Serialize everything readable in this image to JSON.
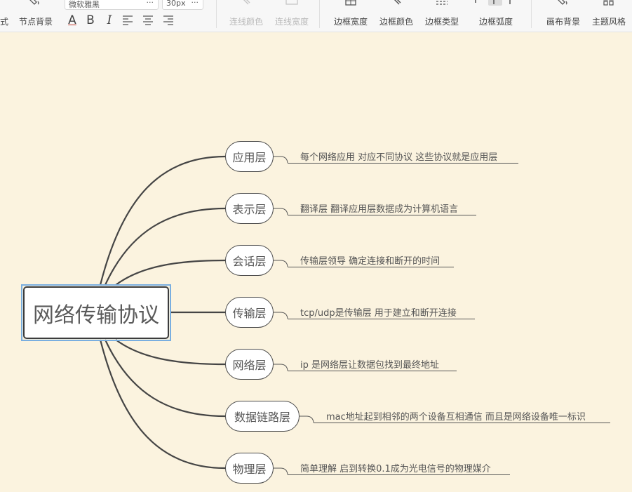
{
  "toolbar": {
    "left_clip": "式",
    "node_bg": "节点背景",
    "font_name": "微软雅黑",
    "font_size": "30px",
    "more": "···",
    "text_color": "A",
    "bold": "B",
    "italic": "I",
    "line_color": "连线颜色",
    "line_width": "连线宽度",
    "border_width": "边框宽度",
    "border_color": "边框颜色",
    "border_type": "边框类型",
    "border_radius": "边框弧度",
    "canvas_bg": "画布背景",
    "theme_style": "主题风格"
  },
  "mindmap": {
    "root": "网络传输协议",
    "branches": [
      {
        "label": "应用层",
        "note": "每个网络应用 对应不同协议 这些协议就是应用层"
      },
      {
        "label": "表示层",
        "note": "翻译层 翻译应用层数据成为计算机语言"
      },
      {
        "label": "会话层",
        "note": "传输层领导 确定连接和断开的时间"
      },
      {
        "label": "传输层",
        "note": "tcp/udp是传输层 用于建立和断开连接"
      },
      {
        "label": "网络层",
        "note": "ip 是网络层让数据包找到最终地址"
      },
      {
        "label": "数据链路层",
        "note": "mac地址起到相邻的两个设备互相通信 而且是网络设备唯一标识"
      },
      {
        "label": "物理层",
        "note": "简单理解 启到转换0.1成为光电信号的物理媒介"
      }
    ]
  },
  "colors": {
    "canvas": "#fbf3df",
    "link": "#454545",
    "selection": "#79aee0"
  }
}
